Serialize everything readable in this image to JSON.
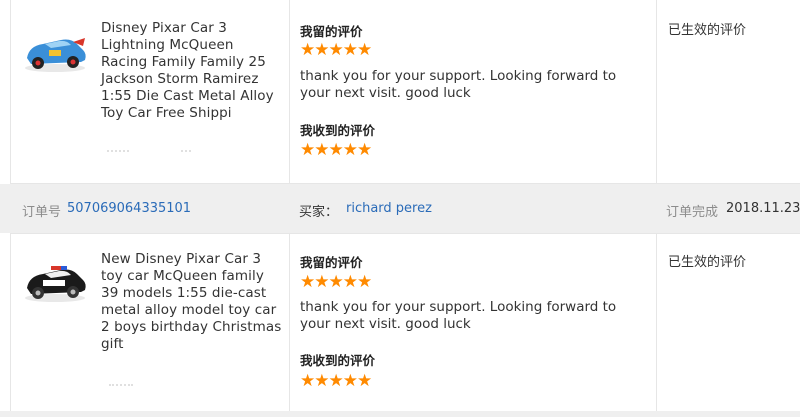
{
  "orders": [
    {
      "product_title": "Disney Pixar Car 3 Lightning McQueen Racing Family Family 25 Jackson Storm Ramirez 1:55 Die Cast Metal Alloy Toy Car Free Shippi",
      "my_review_label": "我留的评价",
      "my_review_stars": "★★★★★",
      "my_review_text": "thank you for your support. Looking forward to your next visit. good luck",
      "received_review_label": "我收到的评价",
      "received_review_stars": "★★★★★",
      "status": "已生效的评价",
      "thumb_color": "#3a8fd8",
      "star_color": "#ff8a00"
    },
    {
      "product_title": "New Disney Pixar Car 3 toy car McQueen family 39 models 1:55 die-cast metal alloy model toy car 2 boys birthday Christmas gift",
      "my_review_label": "我留的评价",
      "my_review_stars": "★★★★★",
      "my_review_text": "thank you for your support. Looking forward to your next visit. good luck",
      "received_review_label": "我收到的评价",
      "received_review_stars": "★★★★★",
      "status": "已生效的评价",
      "thumb_color": "#1a1a1a",
      "star_color": "#ff8a00"
    }
  ],
  "order_bar": {
    "order_no_label": "订单号",
    "order_no": "507069064335101",
    "buyer_label": "买家：",
    "buyer_name": "richard perez",
    "completed_label": "订单完成",
    "completed_date": "2018.11.23"
  },
  "colors": {
    "link": "#2a6bb8",
    "bar_bg": "#efefef"
  }
}
